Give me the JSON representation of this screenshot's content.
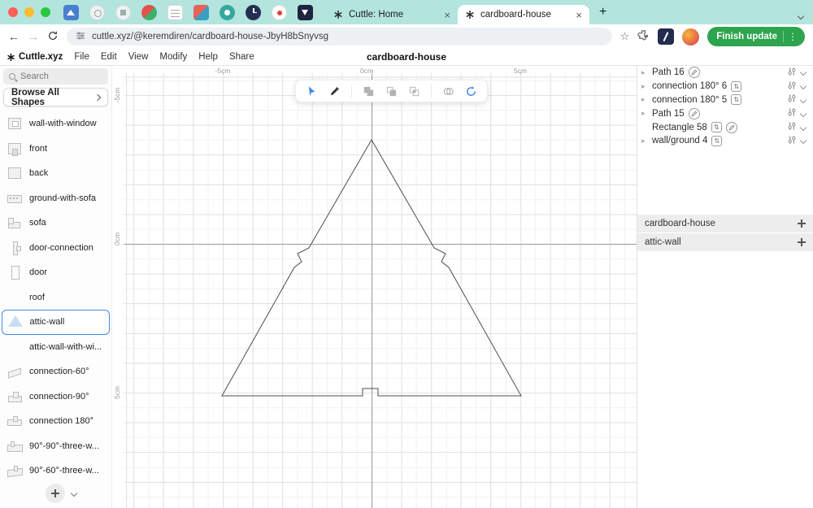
{
  "browser": {
    "tabs": [
      {
        "title": "Cuttle: Home"
      },
      {
        "title": "cardboard-house"
      }
    ],
    "url": "cuttle.xyz/@keremdiren/cardboard-house-JbyH8bSnyvsg",
    "finish_update_label": "Finish update"
  },
  "menubar": {
    "logo": "Cuttle.xyz",
    "items": [
      "File",
      "Edit",
      "View",
      "Modify",
      "Help",
      "Share"
    ],
    "doc_title": "cardboard-house"
  },
  "sidebar": {
    "search_placeholder": "Search",
    "browse_label": "Browse All Shapes",
    "items": [
      {
        "label": "wall-with-window"
      },
      {
        "label": "front"
      },
      {
        "label": "back"
      },
      {
        "label": "ground-with-sofa"
      },
      {
        "label": "sofa"
      },
      {
        "label": "door-connection"
      },
      {
        "label": "door"
      },
      {
        "label": "roof"
      },
      {
        "label": "attic-wall",
        "selected": true
      },
      {
        "label": "attic-wall-with-wi..."
      },
      {
        "label": "connection-60°"
      },
      {
        "label": "connection-90°"
      },
      {
        "label": "connection 180°"
      },
      {
        "label": "90°-90°-three-w..."
      },
      {
        "label": "90°-60°-three-w..."
      }
    ]
  },
  "canvas": {
    "ruler_top": [
      "-5cm",
      "0cm",
      "5cm"
    ],
    "ruler_left": [
      "-5cm",
      "0cm",
      "5cm"
    ],
    "tool_icons": [
      "select",
      "pen",
      "boolean-union",
      "boolean-subtract",
      "boolean-intersect",
      "outline",
      "rotate-copies"
    ]
  },
  "panel": {
    "objects": [
      {
        "label": "Path 16"
      },
      {
        "label": "connection 180° 6"
      },
      {
        "label": "connection 180° 5"
      },
      {
        "label": "Path 15"
      },
      {
        "label": "Rectangle 58"
      },
      {
        "label": "wall/ground 4"
      }
    ],
    "sections": [
      {
        "label": "cardboard-house"
      },
      {
        "label": "attic-wall"
      }
    ]
  },
  "icons": {
    "close": "×",
    "star": "☆",
    "back": "←",
    "forward": "→",
    "ellipsis": "⋮",
    "caret": "▸",
    "badge": "⇅"
  }
}
